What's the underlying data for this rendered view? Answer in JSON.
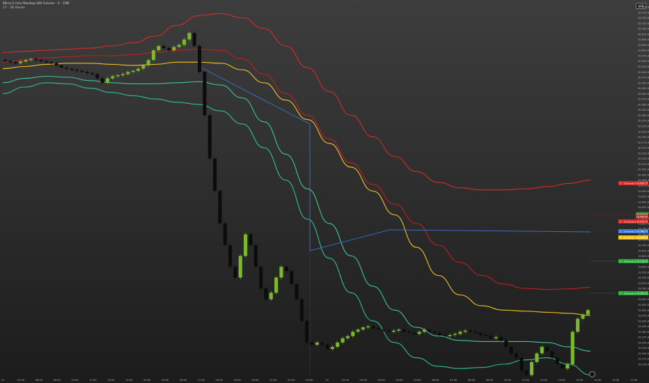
{
  "header": {
    "title": "Micro E-mini Nasdaq-100 Futures · 5 · CME",
    "indicator": "17 · 3D Bands",
    "currency": "USD"
  },
  "chart_data": {
    "type": "candlestick",
    "ylim": [
      19150,
      20800
    ],
    "price_ticks": [
      "20,800.00",
      "20,775.00",
      "20,750.00",
      "20,725.00",
      "20,700.00",
      "20,675.00",
      "20,650.00",
      "20,625.00",
      "20,600.00",
      "20,575.00",
      "20,550.00",
      "20,525.00",
      "20,500.00",
      "20,475.00",
      "20,450.00",
      "20,425.00",
      "20,400.00",
      "20,375.00",
      "20,350.00",
      "20,325.00",
      "20,300.00",
      "20,275.00",
      "20,250.00",
      "20,225.00",
      "20,200.00",
      "20,175.00",
      "20,150.00",
      "20,125.00",
      "20,100.00",
      "20,075.00",
      "20,050.00",
      "20,025.00",
      "20,000.00",
      "19,975.00",
      "19,950.00",
      "19,925.00",
      "19,900.00",
      "19,875.00",
      "19,850.00",
      "19,825.00",
      "19,800.00",
      "19,775.00",
      "19,750.00",
      "19,725.00",
      "19,700.00",
      "19,675.00",
      "19,650.00",
      "19,625.00",
      "19,600.00",
      "19,575.00",
      "19,550.00",
      "19,525.00",
      "19,500.00",
      "19,475.00",
      "19,450.00",
      "19,425.00",
      "19,400.00",
      "19,375.00",
      "19,350.00",
      "19,325.00",
      "19,300.00",
      "19,275.00",
      "19,250.00",
      "19,225.00",
      "19,200.00",
      "19,175.00",
      "19,150.00"
    ],
    "time_labels": [
      "21",
      "07:00",
      "08:00",
      "09:00",
      "10:00",
      "11:00",
      "12:00",
      "13:00",
      "14:00",
      "15:00",
      "16:00",
      "17:00",
      "18:00",
      "19:00",
      "20:00",
      "21:00",
      "22:00",
      "23:00",
      "31",
      "01:00",
      "02:00",
      "03:00",
      "04:00",
      "05:00",
      "06:00",
      "07:00",
      "08:00",
      "09:00",
      "10:00",
      "11:00",
      "12:00",
      "13:00",
      "14:00",
      "15:00",
      "16:00",
      "17:00"
    ],
    "closes": [
      20550,
      20545,
      20540,
      20548,
      20555,
      20560,
      20555,
      20550,
      20545,
      20540,
      20530,
      20520,
      20515,
      20510,
      20505,
      20500,
      20495,
      20490,
      20470,
      20450,
      20470,
      20480,
      20485,
      20490,
      20500,
      20505,
      20515,
      20530,
      20555,
      20600,
      20620,
      20610,
      20600,
      20615,
      20625,
      20650,
      20680,
      20620,
      20500,
      20300,
      20100,
      19950,
      19800,
      19700,
      19600,
      19550,
      19650,
      19750,
      19700,
      19600,
      19500,
      19450,
      19480,
      19550,
      19600,
      19580,
      19520,
      19450,
      19350,
      19250,
      19240,
      19250,
      19240,
      19220,
      19230,
      19250,
      19270,
      19280,
      19300,
      19310,
      19320,
      19325,
      19315,
      19310,
      19305,
      19300,
      19305,
      19310,
      19300,
      19295,
      19290,
      19300,
      19310,
      19300,
      19295,
      19285,
      19280,
      19285,
      19290,
      19300,
      19305,
      19300,
      19295,
      19285,
      19280,
      19270,
      19275,
      19260,
      19230,
      19200,
      19180,
      19120,
      19100,
      19160,
      19200,
      19230,
      19210,
      19180,
      19150,
      19130,
      19150,
      19300,
      19360,
      19380,
      19400
    ],
    "series": [
      {
        "name": "Upper Band 2",
        "color": "#d62b2b",
        "y": [
          20590,
          20595,
          20600,
          20605,
          20610,
          20620,
          20635,
          20665,
          20715,
          20760,
          20770,
          20750,
          20700,
          20620,
          20520,
          20410,
          20300,
          20200,
          20110,
          20040,
          19990,
          19965,
          19955,
          19955,
          19960,
          19970,
          19985,
          20000
        ]
      },
      {
        "name": "Upper Band 1",
        "color": "#c21f1f",
        "y": [
          20545,
          20555,
          20565,
          20570,
          20575,
          20575,
          20580,
          20590,
          20600,
          20605,
          20600,
          20560,
          20490,
          20400,
          20300,
          20190,
          20080,
          19980,
          19890,
          19800,
          19700,
          19620,
          19560,
          19520,
          19500,
          19495,
          19498,
          19505
        ]
      },
      {
        "name": "VWAP",
        "color": "#f2c21b",
        "y": [
          20515,
          20525,
          20535,
          20540,
          20540,
          20535,
          20530,
          20535,
          20545,
          20545,
          20540,
          20510,
          20450,
          20370,
          20280,
          20170,
          20060,
          19950,
          19840,
          19690,
          19560,
          19470,
          19420,
          19400,
          19395,
          19390,
          19385,
          19375
        ]
      },
      {
        "name": "Lower Band 1",
        "color": "#3fc59a",
        "y": [
          20450,
          20470,
          20480,
          20475,
          20460,
          20450,
          20445,
          20445,
          20450,
          20455,
          20440,
          20380,
          20270,
          20120,
          19960,
          19800,
          19650,
          19510,
          19400,
          19320,
          19280,
          19260,
          19255,
          19255,
          19255,
          19250,
          19230,
          19210
        ]
      },
      {
        "name": "Lower Band 2",
        "color": "#2fbf9a",
        "y": [
          20400,
          20430,
          20450,
          20445,
          20425,
          20405,
          20390,
          20375,
          20360,
          20350,
          20320,
          20260,
          20150,
          20000,
          19820,
          19640,
          19480,
          19350,
          19250,
          19180,
          19140,
          19130,
          19135,
          19150,
          19170,
          19180,
          19150,
          19100
        ]
      }
    ],
    "labels": [
      {
        "text": "17 · 3D Bands #2",
        "value": "19,630.75",
        "color": "#d62b2b"
      },
      {
        "text": "17 · 3D Bands #1",
        "value": "19,479.75",
        "color": "#d62b2b"
      },
      {
        "text": "",
        "value": "19,523.00",
        "color": "#27a53a"
      },
      {
        "text": "",
        "value": "19,500.00",
        "color": "#d62b2b"
      },
      {
        "text": "17 · 3D Bands VWAP",
        "value": "19,386.75",
        "color": "#3b78d6"
      },
      {
        "text": "17 · 3D Bands",
        "value": "19,358.50",
        "color": "#f2c21b"
      },
      {
        "text": "17 · 3D Bands #1",
        "value": "19,218.50",
        "color": "#27a53a"
      },
      {
        "text": "17 · 3D Bands #2",
        "value": "19,040.25",
        "color": "#27a53a"
      }
    ],
    "grid": false,
    "legend": "none"
  }
}
